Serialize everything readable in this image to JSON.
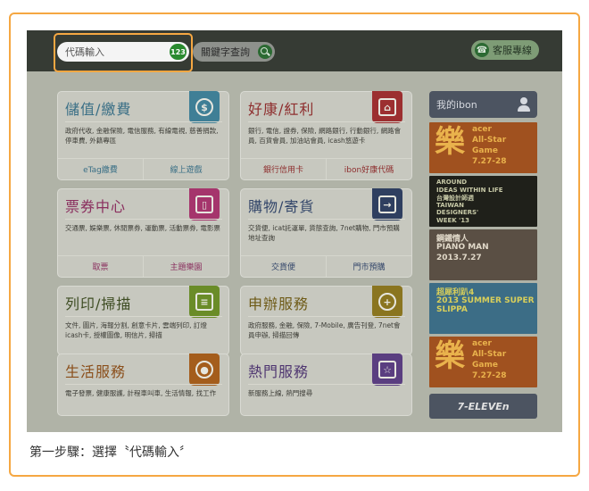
{
  "topbar": {
    "code_input": "代碼輸入",
    "code_badge": "123",
    "keyword_search": "關鍵字查詢",
    "service_button": "客服專線"
  },
  "cards": [
    {
      "title": "儲值/繳費",
      "desc": "政府代收, 金融保險, 電信服務, 有線電視, 慈善捐款, 停車費, 外籍專區",
      "links": [
        "eTag繳費",
        "線上遊戲"
      ],
      "icon": "dollar-icon",
      "title_color": "#3a6f86",
      "icon_color": "#3f7f96",
      "link_color": "#3a6f86"
    },
    {
      "title": "好康/紅利",
      "desc": "銀行, 電信, 證券, 保險, 網路銀行, 行動銀行, 網路會員, 百貨會員, 加油站會員, icash悠遊卡",
      "links": [
        "銀行信用卡",
        "ibon好康代碼"
      ],
      "icon": "home-icon",
      "title_color": "#8e2e2e",
      "icon_color": "#9c2f30",
      "link_color": "#8e2e2e"
    },
    {
      "title": "票券中心",
      "desc": "交通票, 娛樂票, 休閒票券, 運動票, 活動票券, 電影票",
      "links": [
        "取票",
        "主題樂園"
      ],
      "icon": "ticket-icon",
      "title_color": "#8a2e5e",
      "icon_color": "#a5356c",
      "link_color": "#8a2e5e"
    },
    {
      "title": "購物/寄貨",
      "desc": "交貨便, icat託運單, 貨態查詢, 7net購物, 門市預購地址查詢",
      "links": [
        "交貨便",
        "門市預購"
      ],
      "icon": "exit-icon",
      "title_color": "#33466a",
      "icon_color": "#2f3f60",
      "link_color": "#33466a"
    },
    {
      "title": "列印/掃描",
      "desc": "文件, 圖片, 海報分割, 創意卡片, 雲端列印, 訂燈icash卡, 授權圖像, 明信片, 掃描",
      "links": [],
      "icon": "document-icon",
      "title_color": "#3d4c22",
      "icon_color": "#6a8c28",
      "link_color": "#3d4c22"
    },
    {
      "title": "申辦服務",
      "desc": "政府服務, 金融, 保險, 7-Mobile, 廣告刊登, 7net會員申辦, 掃描回傳",
      "links": [],
      "icon": "plus-icon",
      "title_color": "#6e5a16",
      "icon_color": "#8a7520",
      "link_color": "#6e5a16"
    },
    {
      "title": "生活服務",
      "desc": "電子發票, 健康服護, 計程車叫車, 生活情報, 找工作",
      "links": [],
      "icon": "location-icon",
      "title_color": "#8a4e1a",
      "icon_color": "#a45d1c",
      "link_color": "#8a4e1a"
    },
    {
      "title": "熱門服務",
      "desc": "新服務上線, 熱門搜尋",
      "links": [],
      "icon": "star-icon",
      "title_color": "#4e3570",
      "icon_color": "#5a3e80",
      "link_color": "#4e3570"
    }
  ],
  "sidebar": {
    "header": "我的ibon",
    "banners": [
      {
        "big": "樂",
        "lines": [
          "acer",
          "All-Star",
          "Game",
          "7.27-28"
        ],
        "bg": "#a0511f",
        "fg": "#e9b24c"
      },
      {
        "big": "",
        "lines": [
          "AROUND",
          "IDEAS WITHIN LIFE",
          "台灣設計師週",
          "TAIWAN",
          "DESIGNERS'",
          "WEEK '13"
        ],
        "bg": "#1f201a",
        "fg": "#c6c8a6"
      },
      {
        "big": "",
        "lines": [
          "鋼鐵情人",
          "PIANO MAN",
          "2013.7.27"
        ],
        "bg": "#5a4f44",
        "fg": "#e0d8c8"
      },
      {
        "big": "",
        "lines": [
          "超犀利趴4",
          "2013 SUMMER SUPER SLIPPA"
        ],
        "bg": "#3c6d86",
        "fg": "#d9cf5a"
      },
      {
        "big": "樂",
        "lines": [
          "acer",
          "All-Star",
          "Game",
          "7.27-28"
        ],
        "bg": "#a0511f",
        "fg": "#e9b24c"
      }
    ],
    "footer": "7-ELEVEn"
  },
  "caption": "第一步驟：選擇〝代碼輸入〞"
}
